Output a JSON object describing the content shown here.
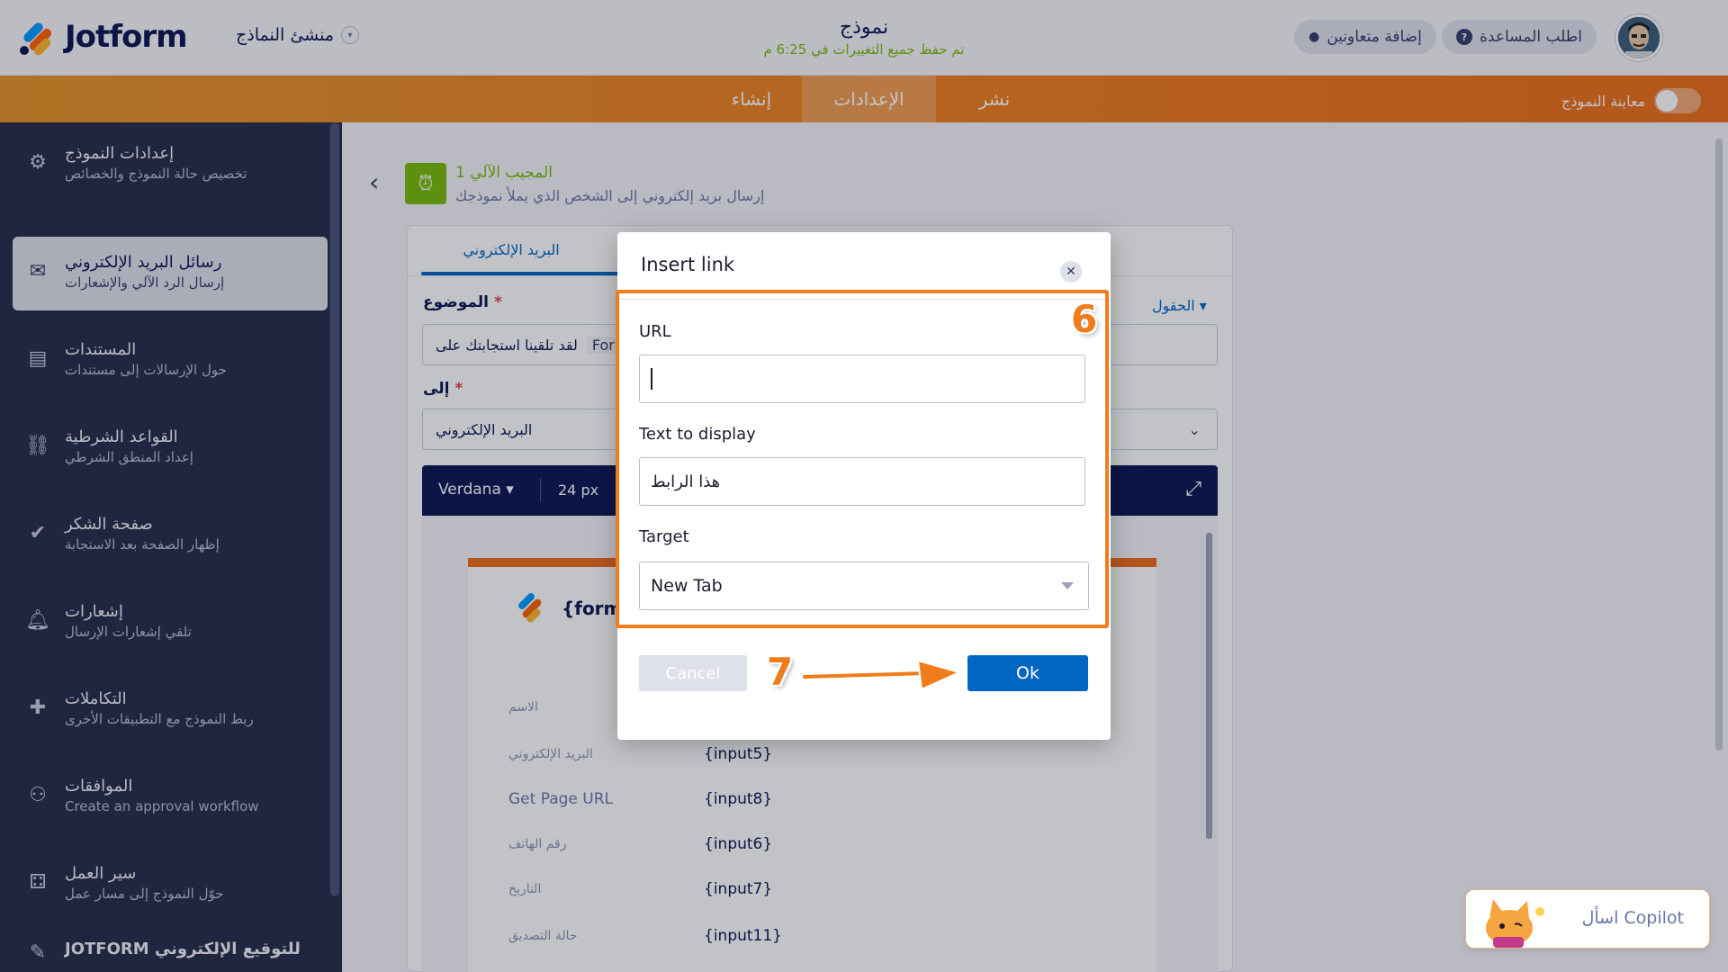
{
  "header": {
    "logo_text": "Jotform",
    "builder_label": "منشئ النماذج",
    "form_title": "نموذج",
    "saved_status": "تم حفظ جميع التغييرات في 6:25 م",
    "help_button": "اطلب المساعدة",
    "add_collaborators_button": "إضافة متعاونين"
  },
  "nav": {
    "tabs": [
      "نشر",
      "الإعدادات",
      "إنشاء"
    ],
    "active_tab": "الإعدادات",
    "preview_label": "معاينة النموذج"
  },
  "sidebar": {
    "items": [
      {
        "title": "إعدادات النموذج",
        "subtitle": "تخصيص حالة النموذج والخصائص",
        "icon": "gear-icon"
      },
      {
        "title": "رسائل البريد الإلكتروني",
        "subtitle": "إرسال الرد الآلي والإشعارات",
        "icon": "envelope-icon"
      },
      {
        "title": "المستندات",
        "subtitle": "حول الإرسالات إلى مستندات",
        "icon": "document-icon"
      },
      {
        "title": "القواعد الشرطية",
        "subtitle": "إعداد المنطق الشرطي",
        "icon": "flowchart-icon"
      },
      {
        "title": "صفحة الشكر",
        "subtitle": "إظهار الصفحة بعد الاستجابة",
        "icon": "check-circle-icon"
      },
      {
        "title": "إشعارات",
        "subtitle": "تلقي إشعارات الإرسال",
        "icon": "bell-icon"
      },
      {
        "title": "التكاملات",
        "subtitle": "ربط النموذج مع التطبيقات الأخرى",
        "icon": "puzzle-icon"
      },
      {
        "title": "الموافقات",
        "subtitle": "Create an approval workflow",
        "icon": "approval-icon"
      },
      {
        "title": "سير العمل",
        "subtitle": "حوّل النموذج إلى مسار عمل",
        "icon": "workflow-icon"
      },
      {
        "title": "JOTFORM للتوقيع الإلكتروني",
        "subtitle": "",
        "icon": "sign-icon"
      }
    ],
    "active_index": 1
  },
  "autoresponder": {
    "title": "المجيب الآلي 1",
    "subtitle": "إرسال بريد إلكتروني إلى الشخص الذي يملأ نموذجك"
  },
  "email_form": {
    "tab_label": "البريد الإلكتروني",
    "subject_label": "الموضوع",
    "subject_value": "لقد تلقينا استجابتك على",
    "subject_tag": "For",
    "fields_link": "الحقول",
    "to_label": "إلى",
    "to_value": "البريد الإلكتروني",
    "font_name": "Verdana",
    "font_size": "24 px",
    "email_tag": "{form",
    "rows": [
      {
        "label": "الاسم",
        "value": ""
      },
      {
        "label": "البريد الإلكتروني",
        "value": "{input5}"
      },
      {
        "label": "Get Page URL",
        "value": "{input8}"
      },
      {
        "label": "رقم الهاتف",
        "value": "{input6}"
      },
      {
        "label": "التاريخ",
        "value": "{input7}"
      },
      {
        "label": "حالة التصديق",
        "value": "{input11}"
      }
    ]
  },
  "copilot": {
    "label": "اسأل Copilot"
  },
  "modal": {
    "title": "Insert link",
    "url_label": "URL",
    "url_value": "",
    "text_label": "Text to display",
    "text_value": "هذا الرابط",
    "target_label": "Target",
    "target_value": "New Tab",
    "cancel_label": "Cancel",
    "ok_label": "Ok"
  },
  "annotations": {
    "step_six": "6",
    "step_seven": "7",
    "highlight_color": "#f07c1c"
  }
}
